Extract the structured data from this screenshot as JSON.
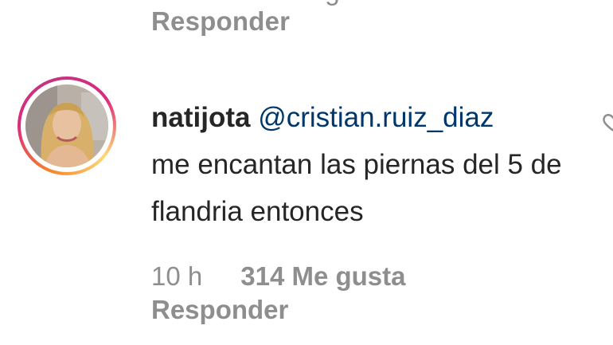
{
  "previous_comment": {
    "cut_text": "g",
    "reply_label": "Responder"
  },
  "comment": {
    "username": "natijota",
    "mention": "@cristian.ruiz_diaz",
    "text": "me encantan las piernas del 5 de flandria entonces",
    "time": "10 h",
    "likes": "314 Me gusta",
    "reply_label": "Responder"
  },
  "icons": {
    "like": "heart-icon",
    "avatar": "profile-photo"
  },
  "colors": {
    "secondary_text": "#8e8e8e",
    "mention": "#00376b",
    "primary_text": "#262626"
  }
}
